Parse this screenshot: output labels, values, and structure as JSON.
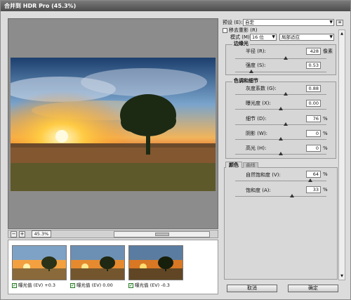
{
  "window": {
    "title": "合并到 HDR Pro (45.3%)"
  },
  "preview": {
    "zoom": "45.3%",
    "zoom_btn_minus": "−",
    "zoom_btn_plus": "+"
  },
  "thumbnails": [
    {
      "label": "曝光值 (EV) +0.3",
      "checked": true
    },
    {
      "label": "曝光值 (EV) 0.00",
      "checked": true
    },
    {
      "label": "曝光值 (EV) -0.3",
      "checked": true
    }
  ],
  "right": {
    "preset_label": "预设 (E):",
    "preset_value": "自定",
    "remove_ghosts": "移去重影 (R)",
    "mode_label": "模式 (M):",
    "bit_value": "16 位",
    "method_value": "局部适应",
    "edge_glow": {
      "title": "边缘光",
      "radius_label": "半径 (R):",
      "radius_value": "428",
      "radius_unit": "像素",
      "radius_pos": 0.55,
      "strength_label": "强度 (S):",
      "strength_value": "0.53",
      "strength_pos": 0.18
    },
    "tone": {
      "title": "色调和细节",
      "gamma_label": "灰度系数 (G):",
      "gamma_value": "0.88",
      "gamma_pos": 0.55,
      "exposure_label": "曝光度 (X):",
      "exposure_value": "0.00",
      "exposure_pos": 0.5,
      "detail_label": "细节 (D):",
      "detail_value": "76",
      "detail_unit": "%",
      "detail_pos": 0.55,
      "shadow_label": "阴影 (W):",
      "shadow_value": "0",
      "shadow_unit": "%",
      "shadow_pos": 0.5,
      "highlight_label": "高光 (H):",
      "highlight_value": "0",
      "highlight_unit": "%",
      "highlight_pos": 0.5
    },
    "color": {
      "tab_color": "颜色",
      "tab_curve": "曲线",
      "vibrance_label": "自然饱和度 (V):",
      "vibrance_value": "64",
      "vibrance_unit": "%",
      "vibrance_pos": 0.82,
      "saturation_label": "饱和度 (A):",
      "saturation_value": "33",
      "saturation_unit": "%",
      "saturation_pos": 0.62
    },
    "cancel": "取消",
    "ok": "确定"
  },
  "colors": {
    "accent": "#2a7a2a"
  }
}
